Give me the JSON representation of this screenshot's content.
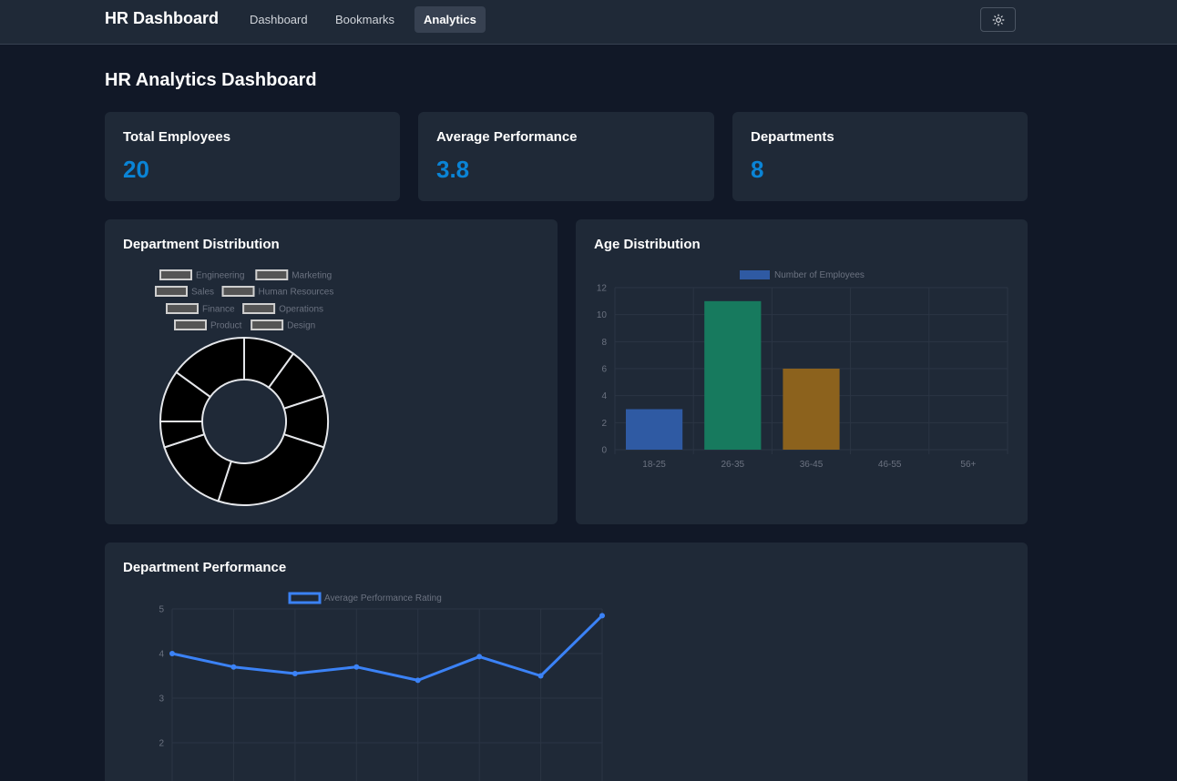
{
  "nav": {
    "brand": "HR Dashboard",
    "links": [
      "Dashboard",
      "Bookmarks",
      "Analytics"
    ],
    "active": "Analytics",
    "theme_icon": "sun-icon"
  },
  "page": {
    "title": "HR Analytics Dashboard"
  },
  "stats": [
    {
      "label": "Total Employees",
      "value": "20"
    },
    {
      "label": "Average Performance",
      "value": "3.8"
    },
    {
      "label": "Departments",
      "value": "8"
    }
  ],
  "colors": {
    "background": "#111827",
    "card": "#1f2937",
    "accent": "#0a84d6",
    "bar_blue": "#2f5aa3",
    "bar_green": "#177a5e",
    "bar_orange": "#8c621d",
    "line_blue": "#3b82f6"
  },
  "chart_data": [
    {
      "type": "pie",
      "title": "Department Distribution",
      "variant": "doughnut",
      "legend": "top",
      "categories": [
        "Engineering",
        "Marketing",
        "Sales",
        "Human Resources",
        "Finance",
        "Operations",
        "Product",
        "Design"
      ],
      "values": [
        2,
        2,
        2,
        5,
        3,
        1,
        2,
        3
      ]
    },
    {
      "type": "bar",
      "title": "Age Distribution",
      "legend": "top",
      "categories": [
        "18-25",
        "26-35",
        "36-45",
        "46-55",
        "56+"
      ],
      "series": [
        {
          "name": "Number of Employees",
          "values": [
            3,
            11,
            6,
            0,
            0
          ]
        }
      ],
      "ylim": [
        0,
        12
      ],
      "yticks": [
        0,
        2,
        4,
        6,
        8,
        10,
        12
      ],
      "grid": true
    },
    {
      "type": "line",
      "title": "Department Performance",
      "legend": "top",
      "series": [
        {
          "name": "Average Performance Rating",
          "values": [
            4.0,
            3.7,
            3.55,
            3.7,
            3.4,
            3.93,
            3.5,
            4.85
          ]
        }
      ],
      "yticks": [
        2,
        3,
        4,
        5
      ],
      "grid": true
    }
  ]
}
